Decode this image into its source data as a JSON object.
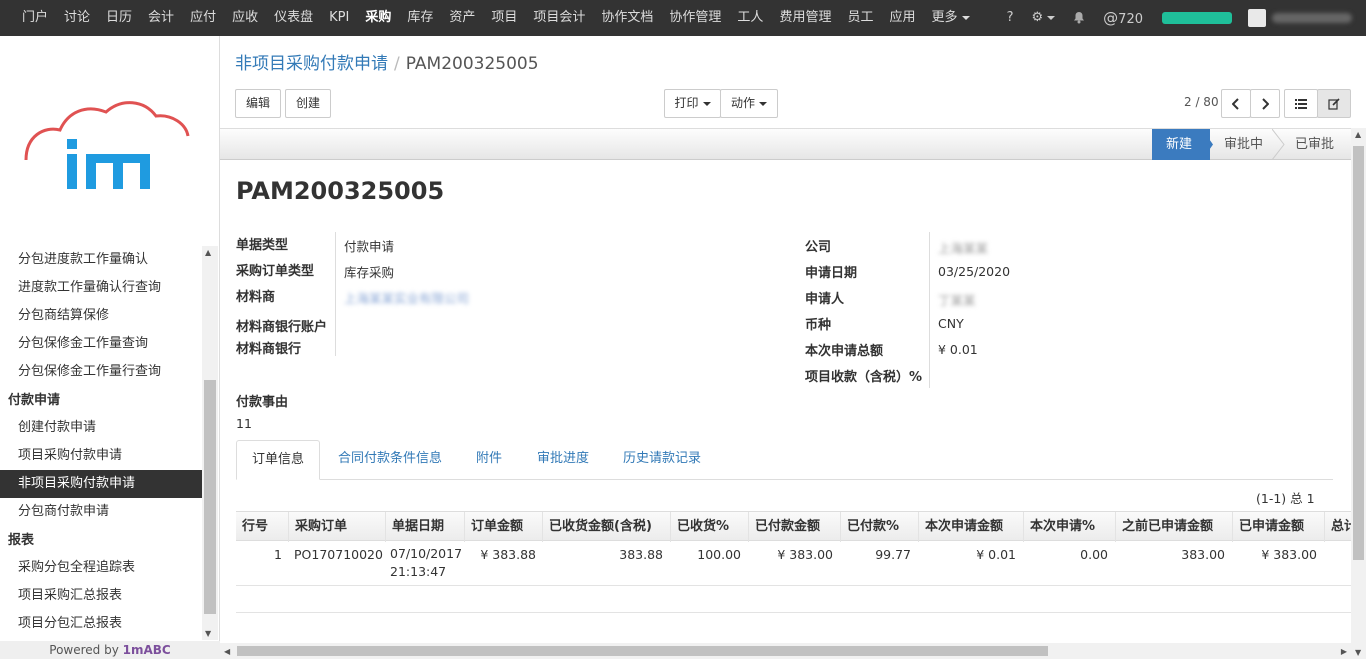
{
  "topnav": {
    "menus": [
      "门户",
      "讨论",
      "日历",
      "会计",
      "应付",
      "应收",
      "仪表盘",
      "KPI",
      "采购",
      "库存",
      "资产",
      "项目",
      "项目会计",
      "协作文档",
      "协作管理",
      "工人",
      "费用管理",
      "员工",
      "应用"
    ],
    "active_menu": "采购",
    "more_label": "更多",
    "help_label": "?",
    "mention_count": "720",
    "progress_color": "#1fbf9a",
    "icons": [
      "gear-icon",
      "bell-icon",
      "at-icon",
      "camera-icon"
    ]
  },
  "sidebar": {
    "powered_by_prefix": "Powered by ",
    "powered_by_brand": "1mABC",
    "sections": [
      {
        "type": "item",
        "label": "分包进度款工作量确认"
      },
      {
        "type": "item",
        "label": "进度款工作量确认行查询"
      },
      {
        "type": "item",
        "label": "分包商结算保修"
      },
      {
        "type": "item",
        "label": "分包保修金工作量查询"
      },
      {
        "type": "item",
        "label": "分包保修金工作量行查询"
      },
      {
        "type": "head",
        "label": "付款申请"
      },
      {
        "type": "item",
        "label": "创建付款申请"
      },
      {
        "type": "item",
        "label": "项目采购付款申请"
      },
      {
        "type": "item",
        "label": "非项目采购付款申请",
        "active": true
      },
      {
        "type": "item",
        "label": "分包商付款申请"
      },
      {
        "type": "head",
        "label": "报表"
      },
      {
        "type": "item",
        "label": "采购分包全程追踪表"
      },
      {
        "type": "item",
        "label": "项目采购汇总报表"
      },
      {
        "type": "item",
        "label": "项目分包汇总报表"
      }
    ]
  },
  "breadcrumb": {
    "parent": "非项目采购付款申请",
    "sep": "/",
    "current": "PAM200325005"
  },
  "toolbar": {
    "edit": "编辑",
    "create": "创建",
    "print": "打印",
    "action": "动作"
  },
  "pager": {
    "value": "2 / 80"
  },
  "status": {
    "stages": [
      "新建",
      "审批中",
      "已审批"
    ],
    "current": "新建",
    "accent": "#3b7bbf"
  },
  "record": {
    "name": "PAM200325005",
    "left_fields": [
      {
        "label": "单据类型",
        "value": "付款申请"
      },
      {
        "label": "采购订单类型",
        "value": "库存采购"
      },
      {
        "label": "材料商",
        "value": "上海某某实业有限公司",
        "blurred": true
      },
      {
        "label": "材料商银行账户",
        "value": ""
      },
      {
        "label": "材料商银行",
        "value": ""
      }
    ],
    "right_fields": [
      {
        "label": "公司",
        "value": "上海某某",
        "blurred": true
      },
      {
        "label": "申请日期",
        "value": "03/25/2020"
      },
      {
        "label": "申请人",
        "value": "丁某某",
        "blurred": true
      },
      {
        "label": "币种",
        "value": "CNY"
      },
      {
        "label": "本次申请总额",
        "value": "¥ 0.01"
      },
      {
        "label": "项目收款（含税）%",
        "value": ""
      }
    ],
    "reason_label": "付款事由",
    "reason_value": "11"
  },
  "tabs": [
    "订单信息",
    "合同付款条件信息",
    "附件",
    "审批进度",
    "历史请款记录"
  ],
  "active_tab": "订单信息",
  "table": {
    "count": "(1-1) 总 1",
    "columns": [
      "行号",
      "采购订单",
      "单据日期",
      "订单金额",
      "已收货金额(含税)",
      "已收货%",
      "已付款金额",
      "已付款%",
      "本次申请金额",
      "本次申请%",
      "之前已申请金额",
      "已申请金额",
      "总计"
    ],
    "rows": [
      [
        "1",
        "PO170710020",
        "07/10/2017 21:13:47",
        "¥ 383.88",
        "383.88",
        "100.00",
        "¥ 383.00",
        "99.77",
        "¥ 0.01",
        "0.00",
        "383.00",
        "¥ 383.00",
        ""
      ]
    ]
  }
}
